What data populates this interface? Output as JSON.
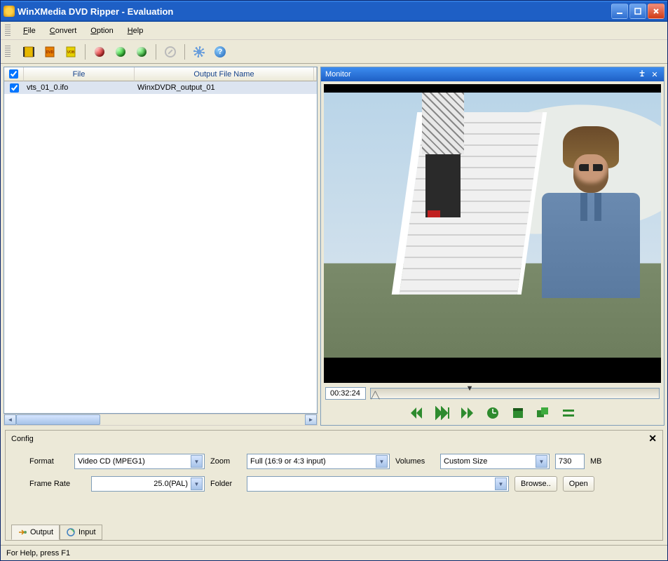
{
  "titlebar": {
    "text": "WinXMedia DVD Ripper - Evaluation"
  },
  "menu": {
    "file": "File",
    "convert": "Convert",
    "option": "Option",
    "help": "Help"
  },
  "table": {
    "headers": {
      "file": "File",
      "output": "Output File Name"
    },
    "rows": [
      {
        "file": "vts_01_0.ifo",
        "output": "WinxDVDR_output_01"
      }
    ]
  },
  "monitor": {
    "title": "Monitor",
    "time": "00:32:24"
  },
  "config": {
    "title": "Config",
    "labels": {
      "format": "Format",
      "zoom": "Zoom",
      "volumes": "Volumes",
      "mb": "MB",
      "framerate": "Frame Rate",
      "folder": "Folder"
    },
    "format": "Video CD (MPEG1)",
    "zoom": "Full (16:9 or 4:3 input)",
    "volumes": "Custom Size",
    "volumesize": "730",
    "framerate": "25.0(PAL)",
    "folder": "",
    "browse": "Browse..",
    "open": "Open",
    "tabs": {
      "output": "Output",
      "input": "Input"
    }
  },
  "statusbar": {
    "text": "For Help, press F1"
  }
}
